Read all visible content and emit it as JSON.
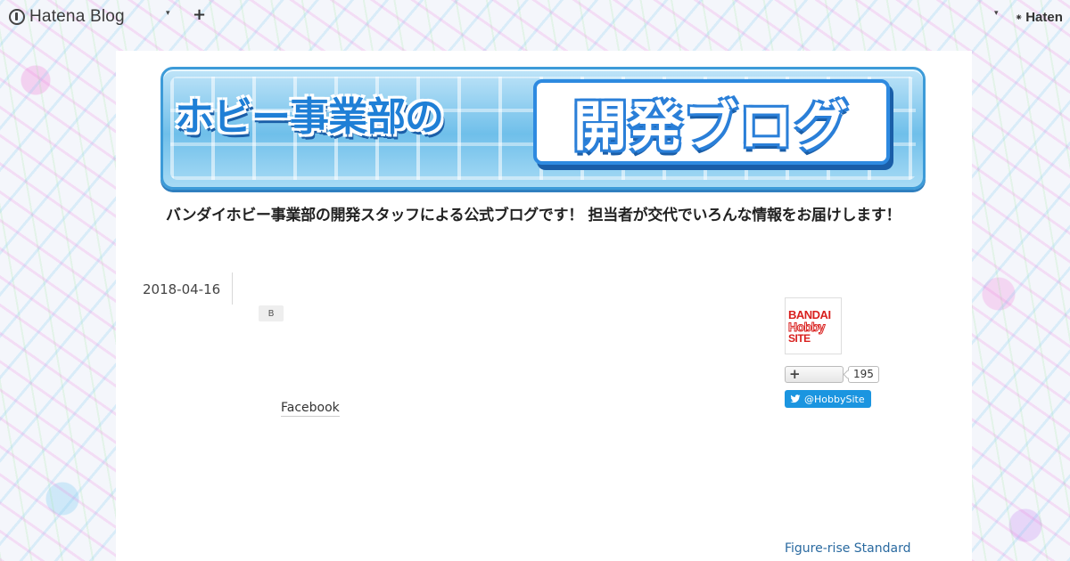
{
  "topbar": {
    "logo_text": "Hatena Blog",
    "caret": "▾",
    "plus": "+",
    "right_logo_text": "Haten"
  },
  "banner": {
    "title_left": "ホビー事業部の",
    "title_right": "開発ブログ",
    "tagline": "バンダイホビー事業部の開発スタッフによる公式ブログです！ 担当者が交代でいろんな情報をお届けします！"
  },
  "entry": {
    "date": "2018-04-16",
    "bookmark_label": "B",
    "facebook_label": "Facebook"
  },
  "sidebar": {
    "profile_logo": {
      "line1": "BANDAI",
      "line2": "Hobby",
      "line3": "SITE"
    },
    "subscribe_label": "+",
    "subscribe_count": "195",
    "twitter_label": "@HobbySite",
    "category_link": "Figure-rise Standard"
  },
  "colors": {
    "accent_blue": "#1f7fd6",
    "twitter_blue": "#1b95e0",
    "bandai_red": "#d9201e",
    "link_blue": "#2a6aa0"
  }
}
